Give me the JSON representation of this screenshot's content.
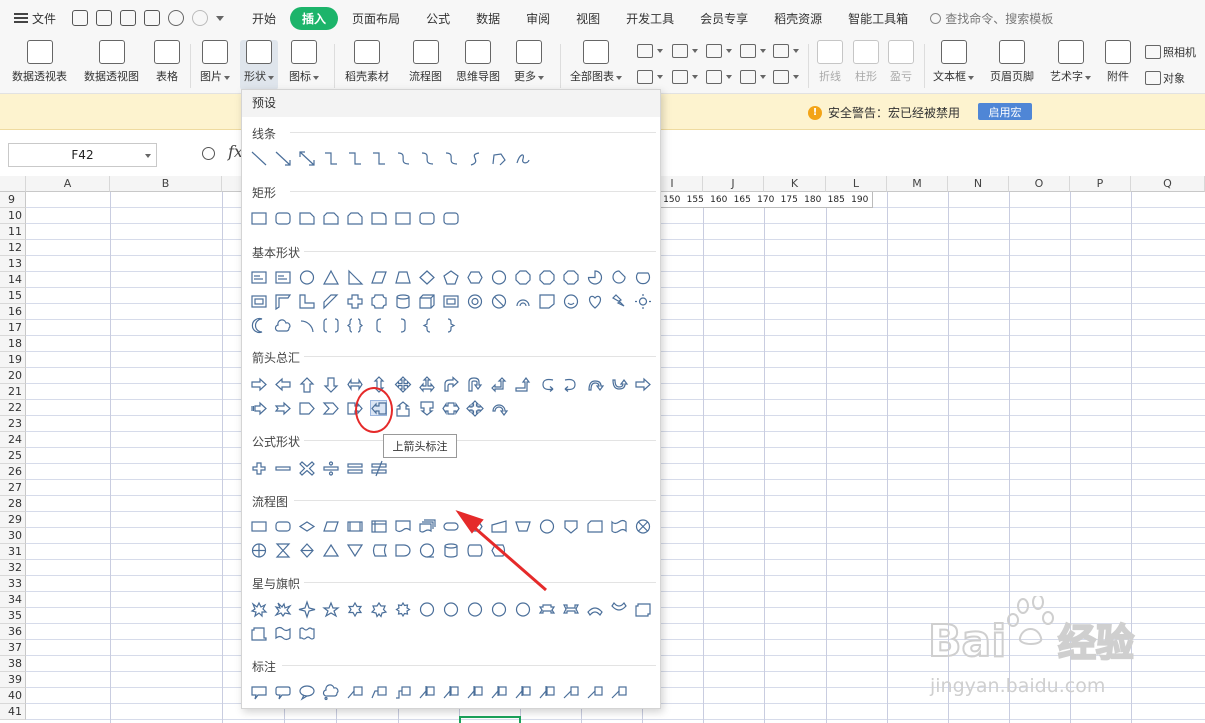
{
  "menubar": {
    "file_label": "文件",
    "tabs": [
      "开始",
      "插入",
      "页面布局",
      "公式",
      "数据",
      "审阅",
      "视图",
      "开发工具",
      "会员专享",
      "稻壳资源",
      "智能工具箱"
    ],
    "active_tab": "插入",
    "search_placeholder": "查找命令、搜索模板"
  },
  "ribbon": {
    "buttons": [
      {
        "label": "数据透视表",
        "icon": "pivot-table-icon"
      },
      {
        "label": "数据透视图",
        "icon": "pivot-chart-icon"
      },
      {
        "label": "表格",
        "icon": "table-icon"
      },
      {
        "label": "图片",
        "icon": "picture-icon"
      },
      {
        "label": "形状",
        "icon": "shapes-icon"
      },
      {
        "label": "图标",
        "icon": "icons-icon"
      },
      {
        "label": "稻壳素材",
        "icon": "material-icon"
      },
      {
        "label": "流程图",
        "icon": "flowchart-icon"
      },
      {
        "label": "思维导图",
        "icon": "mindmap-icon"
      },
      {
        "label": "更多",
        "icon": "more-icon"
      },
      {
        "label": "全部图表",
        "icon": "all-charts-icon"
      },
      {
        "label": "折线",
        "icon": "sparkline-line-icon"
      },
      {
        "label": "柱形",
        "icon": "sparkline-column-icon"
      },
      {
        "label": "盈亏",
        "icon": "sparkline-winloss-icon"
      },
      {
        "label": "文本框",
        "icon": "textbox-icon"
      },
      {
        "label": "页眉页脚",
        "icon": "header-footer-icon"
      },
      {
        "label": "艺术字",
        "icon": "wordart-icon"
      },
      {
        "label": "附件",
        "icon": "attachment-icon"
      },
      {
        "label": "照相机",
        "icon": "camera-icon"
      },
      {
        "label": "对象",
        "icon": "object-icon"
      }
    ]
  },
  "security": {
    "message": "安全警告：宏已经被禁用",
    "button": "启用宏"
  },
  "formula_bar": {
    "cell_ref": "F42",
    "fx": "fx"
  },
  "grid": {
    "columns": [
      "A",
      "B",
      "I",
      "J",
      "K",
      "L",
      "M",
      "N",
      "O",
      "P",
      "Q"
    ],
    "rows": [
      "9",
      "10",
      "11",
      "12",
      "13",
      "14",
      "15",
      "16",
      "17",
      "18",
      "19",
      "20",
      "21",
      "22",
      "23",
      "24",
      "25",
      "26",
      "27",
      "28",
      "29",
      "30",
      "31",
      "32",
      "33",
      "34",
      "35",
      "36",
      "37",
      "38",
      "39",
      "40",
      "41"
    ],
    "row9_values": [
      "150",
      "155",
      "160",
      "165",
      "170",
      "175",
      "180",
      "185",
      "190"
    ]
  },
  "shapes_panel": {
    "preset_label": "预设",
    "sections": [
      "线条",
      "矩形",
      "基本形状",
      "箭头总汇",
      "公式形状",
      "流程图",
      "星与旗帜",
      "标注"
    ],
    "tooltip": "上箭头标注",
    "highlighted_shape": "up-arrow-callout"
  },
  "watermark": {
    "brand": "Bai",
    "brand_cn": "经验",
    "url": "jingyan.baidu.com"
  },
  "colors": {
    "accent_green": "#1cb46a",
    "warning_bg": "#fdf3cf",
    "enable_btn": "#4f86d6",
    "annotation_red": "#e52a2a",
    "shape_stroke": "#4b6f9a"
  }
}
